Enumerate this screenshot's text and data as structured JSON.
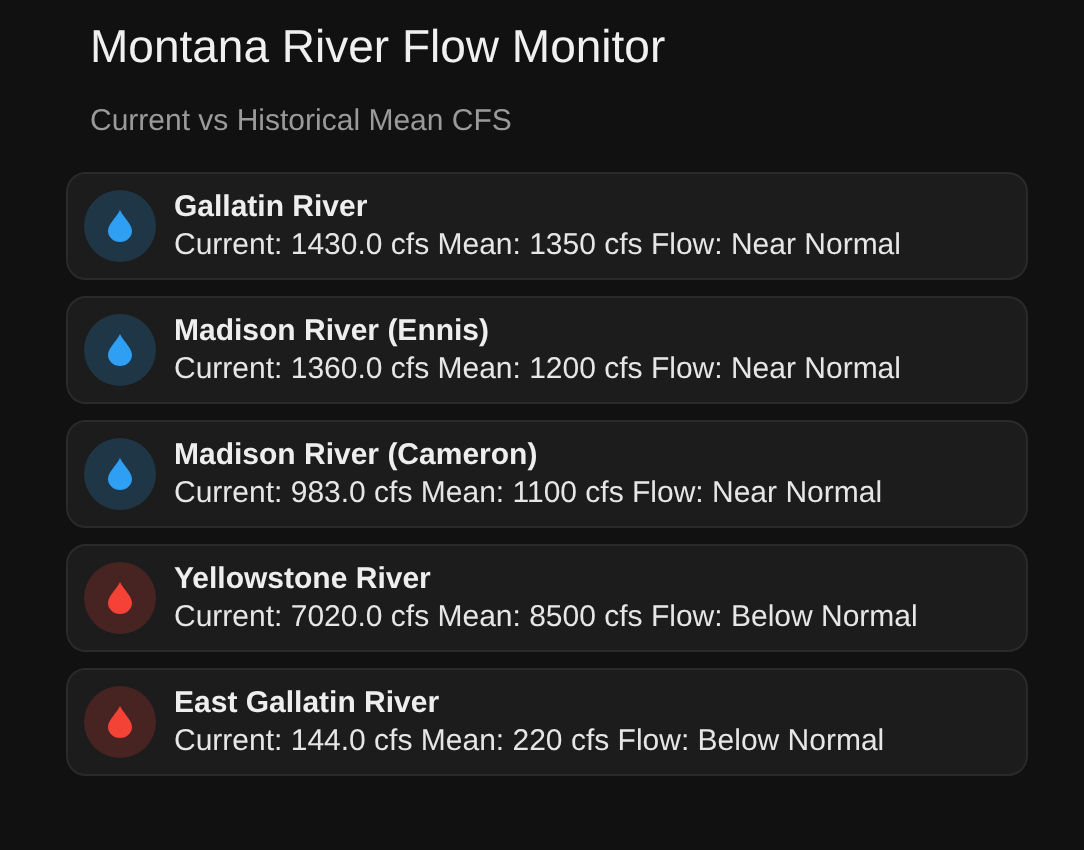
{
  "title": "Montana River Flow Monitor",
  "subtitle": "Current vs Historical Mean CFS",
  "rivers": [
    {
      "name": "Gallatin River",
      "detail": "Current: 1430.0 cfs Mean: 1350 cfs Flow: Near Normal",
      "color": "#2f9ff3"
    },
    {
      "name": "Madison River (Ennis)",
      "detail": "Current: 1360.0 cfs Mean: 1200 cfs Flow: Near Normal",
      "color": "#2f9ff3"
    },
    {
      "name": "Madison River (Cameron)",
      "detail": "Current: 983.0 cfs Mean: 1100 cfs Flow: Near Normal",
      "color": "#2f9ff3"
    },
    {
      "name": "Yellowstone River",
      "detail": "Current: 7020.0 cfs Mean: 8500 cfs Flow: Below Normal",
      "color": "#f44336"
    },
    {
      "name": "East Gallatin River",
      "detail": "Current: 144.0 cfs Mean: 220 cfs Flow: Below Normal",
      "color": "#f44336"
    }
  ]
}
